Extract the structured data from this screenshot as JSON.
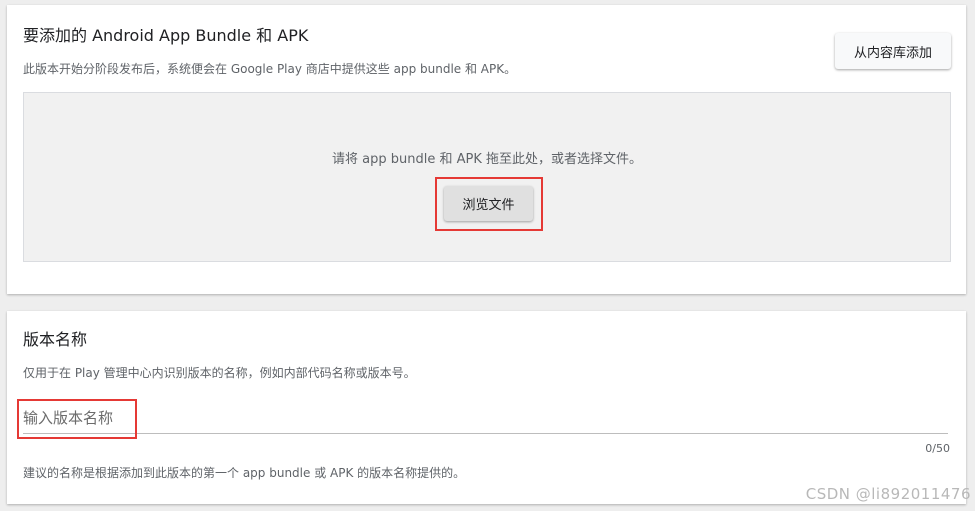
{
  "upload_section": {
    "title": "要添加的 Android App Bundle 和 APK",
    "subtitle": "此版本开始分阶段发布后，系统便会在 Google Play 商店中提供这些 app bundle 和 APK。",
    "add_from_library_label": "从内容库添加",
    "dropzone_text": "请将 app bundle 和 APK 拖至此处，或者选择文件。",
    "browse_label": "浏览文件"
  },
  "version_section": {
    "title": "版本名称",
    "subtitle": "仅用于在 Play 管理中心内识别版本的名称，例如内部代码名称或版本号。",
    "input_value": "",
    "input_placeholder": "输入版本名称",
    "char_count": "0/50",
    "helper": "建议的名称是根据添加到此版本的第一个 app bundle 或 APK 的版本名称提供的。"
  },
  "watermark": "CSDN @li892011476",
  "colors": {
    "highlight_border": "#e53935",
    "dropzone_bg": "#f1f1f1",
    "page_bg": "#eeeeee"
  }
}
